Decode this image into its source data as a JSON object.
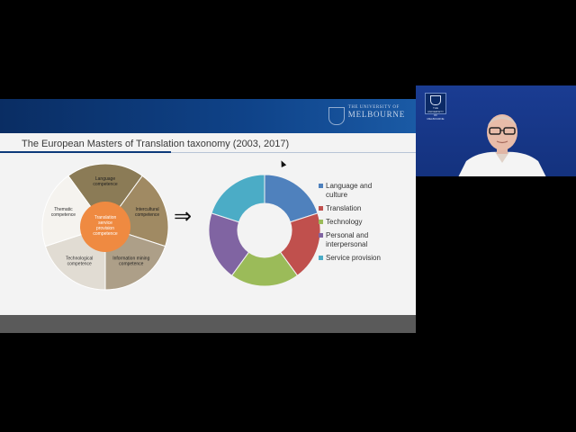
{
  "slide": {
    "logo": {
      "line1": "THE UNIVERSITY OF",
      "line2": "MELBOURNE"
    },
    "title": "The European Masters of Translation taxonomy (2003, 2017)",
    "arrow": "⇒",
    "wheel": {
      "center": [
        "Translation",
        "service",
        "provision",
        "competence"
      ],
      "segments": [
        {
          "label": [
            "Language",
            "competence"
          ],
          "color": "#8b7b56"
        },
        {
          "label": [
            "Intercultural",
            "competence"
          ],
          "color": "#a08a63"
        },
        {
          "label": [
            "Information mining",
            "competence"
          ],
          "color": "#ad9f88"
        },
        {
          "label": [
            "Technological",
            "competence"
          ],
          "color": "#e1dcd3"
        },
        {
          "label": [
            "Thematic",
            "competence"
          ],
          "color": "#f5f3ef"
        }
      ],
      "center_color": "#ef8a41"
    }
  },
  "chart_data": {
    "type": "pie",
    "style": "donut",
    "categories": [
      "Language and culture",
      "Translation",
      "Technology",
      "Personal and interpersonal",
      "Service provision"
    ],
    "values": [
      20,
      20,
      20,
      20,
      20
    ],
    "colors": [
      "#4f81bd",
      "#c0504d",
      "#9bbb59",
      "#8064a2",
      "#4bacc6"
    ],
    "legend": "right"
  },
  "legend": [
    {
      "label": "Language and culture",
      "color": "#4f81bd"
    },
    {
      "label": "Translation",
      "color": "#c0504d"
    },
    {
      "label": "Technology",
      "color": "#9bbb59"
    },
    {
      "label": "Personal and interpersonal",
      "color": "#8064a2"
    },
    {
      "label": "Service provision",
      "color": "#4bacc6"
    }
  ],
  "video": {
    "logo_line1": "THE UNIVERSITY OF",
    "logo_line2": "MELBOURNE"
  }
}
